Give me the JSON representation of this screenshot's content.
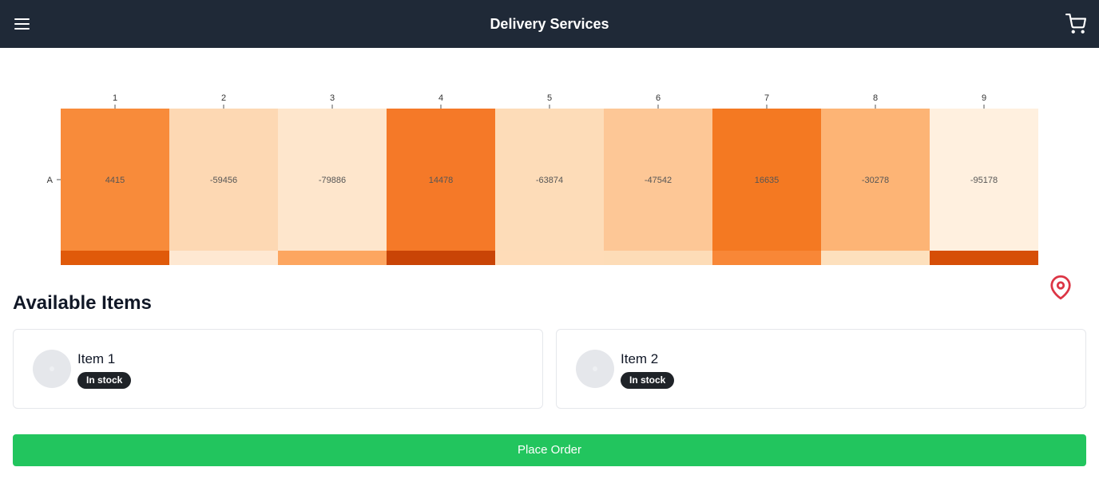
{
  "header": {
    "title": "Delivery Services",
    "menu_icon": "hamburger-menu-icon",
    "cart_icon": "shopping-cart-icon"
  },
  "chart_data": {
    "type": "heatmap",
    "rows": [
      "A"
    ],
    "columns": [
      "1",
      "2",
      "3",
      "4",
      "5",
      "6",
      "7",
      "8",
      "9"
    ],
    "values": [
      [
        4415,
        -59456,
        -79886,
        14478,
        -63874,
        -47542,
        16635,
        -30278,
        -95178
      ]
    ],
    "cell_colors": [
      "#f88b3a",
      "#fdd8b3",
      "#fee6cc",
      "#f57928",
      "#fddcb8",
      "#fdc796",
      "#f47922",
      "#fdb475",
      "#fff0df"
    ],
    "secondary_colors": [
      "#e05a0a",
      "#fee8d2",
      "#fda660",
      "#c94406",
      "#fedcb8",
      "#fddcb7",
      "#f88737",
      "#fde0bd",
      "#d64e07"
    ],
    "colorscale": "oranges"
  },
  "map_marker_icon": "map-pin-icon",
  "items_section": {
    "title": "Available Items",
    "items": [
      {
        "name": "Item 1",
        "status": "In stock"
      },
      {
        "name": "Item 2",
        "status": "In stock"
      }
    ]
  },
  "actions": {
    "place_order": "Place Order"
  },
  "colors": {
    "header_bg": "#1f2937",
    "primary_action": "#22c55e",
    "badge_bg": "#1f2328",
    "marker": "#dc3545"
  }
}
